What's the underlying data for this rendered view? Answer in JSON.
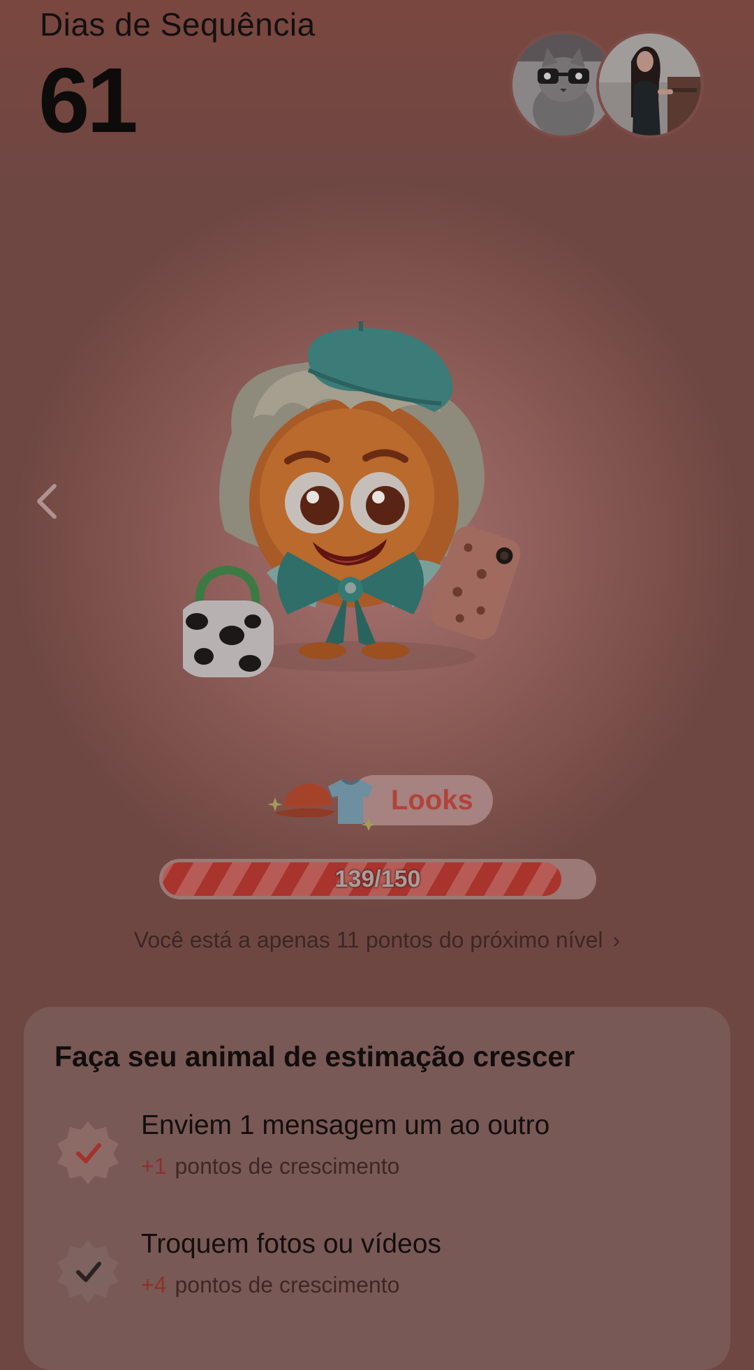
{
  "streak": {
    "label": "Dias de Sequência",
    "count": "61"
  },
  "avatars": [
    {
      "name": "avatar-cat-with-glasses"
    },
    {
      "name": "avatar-woman-photo"
    }
  ],
  "nav": {
    "prev_icon": "chevron-left-icon"
  },
  "pet": {
    "icon": "pet-character-illustration"
  },
  "looks": {
    "label": "Looks",
    "icons": [
      "cap-icon",
      "tshirt-icon",
      "sparkle-icon"
    ]
  },
  "progress": {
    "current": 139,
    "max": 150,
    "text": "139/150",
    "fill_color": "#a8342d"
  },
  "hint": {
    "text": "Você está a apenas 11 pontos do próximo nível",
    "chevron": "›"
  },
  "tasks_card": {
    "title": "Faça seu animal de estimação crescer",
    "tasks": [
      {
        "title": "Enviem 1 mensagem um ao outro",
        "points": "+1",
        "points_label": "pontos de crescimento",
        "status": "done"
      },
      {
        "title": "Troquem fotos ou vídeos",
        "points": "+4",
        "points_label": "pontos de crescimento",
        "status": "pending"
      }
    ]
  }
}
